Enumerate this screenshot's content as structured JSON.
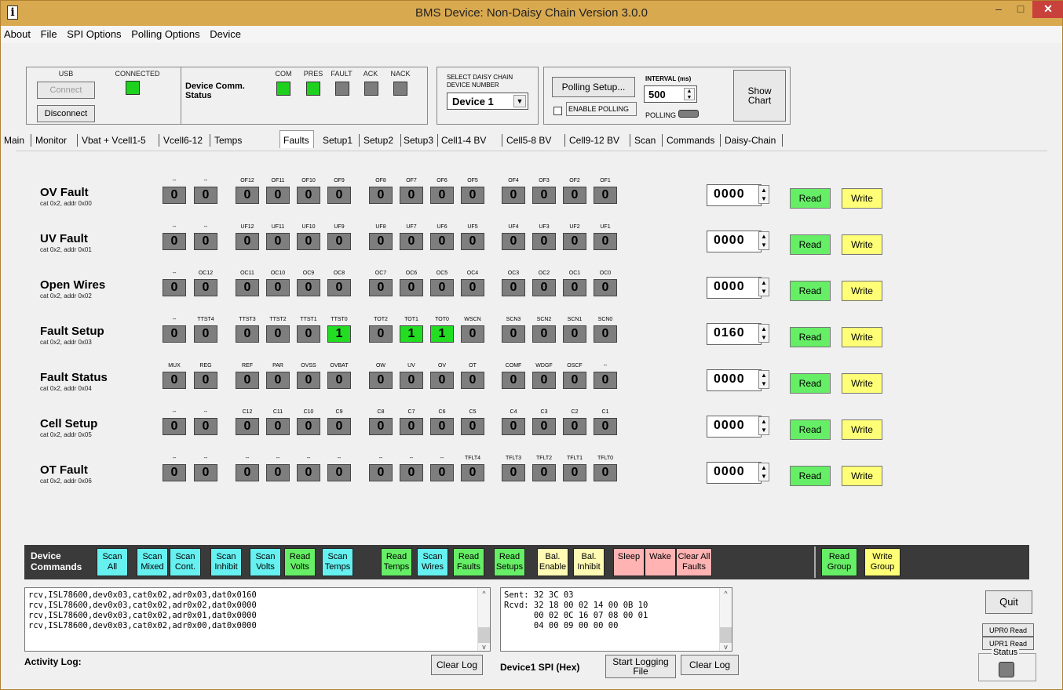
{
  "window": {
    "title": "BMS Device: Non-Daisy Chain  Version 3.0.0",
    "icon": "i",
    "min_glyph": "–",
    "max_glyph": "□",
    "close_glyph": "✕"
  },
  "menu": [
    "About",
    "File",
    "SPI Options",
    "Polling Options",
    "Device"
  ],
  "usb": {
    "label": "USB",
    "connected_label": "CONNECTED",
    "connect_btn": "Connect",
    "disconnect_btn": "Disconnect"
  },
  "comm_status": {
    "label": "Device Comm. Status",
    "leds": [
      {
        "label": "COM",
        "state": "green"
      },
      {
        "label": "PRES",
        "state": "green"
      },
      {
        "label": "FAULT",
        "state": "gray"
      },
      {
        "label": "ACK",
        "state": "gray"
      },
      {
        "label": "NACK",
        "state": "gray"
      }
    ]
  },
  "daisy_select": {
    "label": "SELECT DAISY CHAIN DEVICE NUMBER",
    "value": "Device 1",
    "arrow": "▼"
  },
  "polling": {
    "setup_btn": "Polling Setup...",
    "enable_label": "ENABLE POLLING",
    "interval_label": "INTERVAL (ms)",
    "interval_value": "500",
    "polling_label": "POLLING",
    "show_chart_btn": "Show Chart"
  },
  "tabs": [
    "Main",
    "Monitor",
    "Vbat + Vcell1-5",
    "Vcell6-12",
    "Temps",
    "Faults",
    "Setup1",
    "Setup2",
    "Setup3",
    "Cell1-4 BV",
    "Cell5-8 BV",
    "Cell9-12 BV",
    "Scan",
    "Commands",
    "Daisy-Chain"
  ],
  "active_tab": "Faults",
  "registers": [
    {
      "name": "OV Fault",
      "sub": "cat 0x2, addr 0x00",
      "hex": "0000",
      "bits": [
        "--",
        "--",
        "OF12",
        "OF11",
        "OF10",
        "OF9",
        "OF8",
        "OF7",
        "OF6",
        "OF5",
        "OF4",
        "OF3",
        "OF2",
        "OF1"
      ],
      "values": [
        "0",
        "0",
        "0",
        "0",
        "0",
        "0",
        "0",
        "0",
        "0",
        "0",
        "0",
        "0",
        "0",
        "0"
      ]
    },
    {
      "name": "UV Fault",
      "sub": "cat 0x2, addr 0x01",
      "hex": "0000",
      "bits": [
        "--",
        "--",
        "UF12",
        "UF11",
        "UF10",
        "UF9",
        "UF8",
        "UF7",
        "UF6",
        "UF5",
        "UF4",
        "UF3",
        "UF2",
        "UF1"
      ],
      "values": [
        "0",
        "0",
        "0",
        "0",
        "0",
        "0",
        "0",
        "0",
        "0",
        "0",
        "0",
        "0",
        "0",
        "0"
      ]
    },
    {
      "name": "Open Wires",
      "sub": "cat 0x2, addr 0x02",
      "hex": "0000",
      "bits": [
        "--",
        "OC12",
        "OC11",
        "OC10",
        "OC9",
        "OC8",
        "OC7",
        "OC6",
        "OC5",
        "OC4",
        "OC3",
        "OC2",
        "OC1",
        "OC0"
      ],
      "values": [
        "0",
        "0",
        "0",
        "0",
        "0",
        "0",
        "0",
        "0",
        "0",
        "0",
        "0",
        "0",
        "0",
        "0"
      ]
    },
    {
      "name": "Fault Setup",
      "sub": "cat 0x2, addr 0x03",
      "hex": "0160",
      "bits": [
        "--",
        "TTST4",
        "TTST3",
        "TTST2",
        "TTST1",
        "TTST0",
        "TOT2",
        "TOT1",
        "TOT0",
        "WSCN",
        "SCN3",
        "SCN2",
        "SCN1",
        "SCN0"
      ],
      "values": [
        "0",
        "0",
        "0",
        "0",
        "0",
        "1",
        "0",
        "1",
        "1",
        "0",
        "0",
        "0",
        "0",
        "0"
      ]
    },
    {
      "name": "Fault Status",
      "sub": "cat 0x2, addr 0x04",
      "hex": "0000",
      "bits": [
        "MUX",
        "REG",
        "REF",
        "PAR",
        "OVSS",
        "OVBAT",
        "OW",
        "UV",
        "OV",
        "OT",
        "COMF",
        "WDGF",
        "OSCF",
        "--"
      ],
      "values": [
        "0",
        "0",
        "0",
        "0",
        "0",
        "0",
        "0",
        "0",
        "0",
        "0",
        "0",
        "0",
        "0",
        "0"
      ]
    },
    {
      "name": "Cell Setup",
      "sub": "cat 0x2, addr 0x05",
      "hex": "0000",
      "bits": [
        "--",
        "--",
        "C12",
        "C11",
        "C10",
        "C9",
        "C8",
        "C7",
        "C6",
        "C5",
        "C4",
        "C3",
        "C2",
        "C1"
      ],
      "values": [
        "0",
        "0",
        "0",
        "0",
        "0",
        "0",
        "0",
        "0",
        "0",
        "0",
        "0",
        "0",
        "0",
        "0"
      ]
    },
    {
      "name": "OT Fault",
      "sub": "cat 0x2, addr 0x06",
      "hex": "0000",
      "bits": [
        "--",
        "--",
        "--",
        "--",
        "--",
        "--",
        "--",
        "--",
        "--",
        "TFLT4",
        "TFLT3",
        "TFLT2",
        "TFLT1",
        "TFLT0"
      ],
      "values": [
        "0",
        "0",
        "0",
        "0",
        "0",
        "0",
        "0",
        "0",
        "0",
        "0",
        "0",
        "0",
        "0",
        "0"
      ]
    }
  ],
  "row_buttons": {
    "read": "Read",
    "write": "Write",
    "spin_up": "▲",
    "spin_down": "▼"
  },
  "commands": {
    "title": "Device Commands",
    "buttons": [
      {
        "label": "Scan All",
        "color": "cyan"
      },
      {
        "label": "Scan Mixed",
        "color": "cyan"
      },
      {
        "label": "Scan Cont.",
        "color": "cyan"
      },
      {
        "label": "Scan Inhibit",
        "color": "cyan"
      },
      {
        "label": "Scan Volts",
        "color": "cyan"
      },
      {
        "label": "Read Volts",
        "color": "green"
      },
      {
        "label": "Scan Temps",
        "color": "cyan"
      },
      {
        "label": "Read Temps",
        "color": "green"
      },
      {
        "label": "Scan Wires",
        "color": "cyan"
      },
      {
        "label": "Read Faults",
        "color": "green"
      },
      {
        "label": "Read Setups",
        "color": "green"
      },
      {
        "label": "Bal. Enable",
        "color": "cream"
      },
      {
        "label": "Bal. Inhibit",
        "color": "cream"
      },
      {
        "label": "Sleep",
        "color": "pink"
      },
      {
        "label": "Wake",
        "color": "pink"
      },
      {
        "label": "Clear All Faults",
        "color": "pink"
      },
      {
        "label": "Read Group",
        "color": "green"
      },
      {
        "label": "Write Group",
        "color": "yellow"
      }
    ]
  },
  "activity_log": {
    "lines": "rcv,ISL78600,dev0x03,cat0x02,adr0x03,dat0x0160\nrcv,ISL78600,dev0x03,cat0x02,adr0x02,dat0x0000\nrcv,ISL78600,dev0x03,cat0x02,adr0x01,dat0x0000\nrcv,ISL78600,dev0x03,cat0x02,adr0x00,dat0x0000",
    "label": "Activity Log:",
    "clear_btn": "Clear Log"
  },
  "spi_log": {
    "lines": "Sent: 32 3C 03\nRcvd: 32 18 00 02 14 00 0B 10\n      00 02 0C 16 07 08 00 01\n      04 00 09 00 00 00",
    "label": "Device1 SPI (Hex)",
    "start_btn": "Start Logging File",
    "clear_btn": "Clear Log"
  },
  "side": {
    "quit_btn": "Quit",
    "upr0_btn": "UPR0 Read",
    "upr1_btn": "UPR1 Read",
    "status_label": "Status"
  },
  "colors": {
    "title_bar": "#d9a94f",
    "led_green": "#1fd11f",
    "led_gray": "#7d7d7d",
    "read_btn": "#66ee66",
    "write_btn": "#ffff77"
  }
}
